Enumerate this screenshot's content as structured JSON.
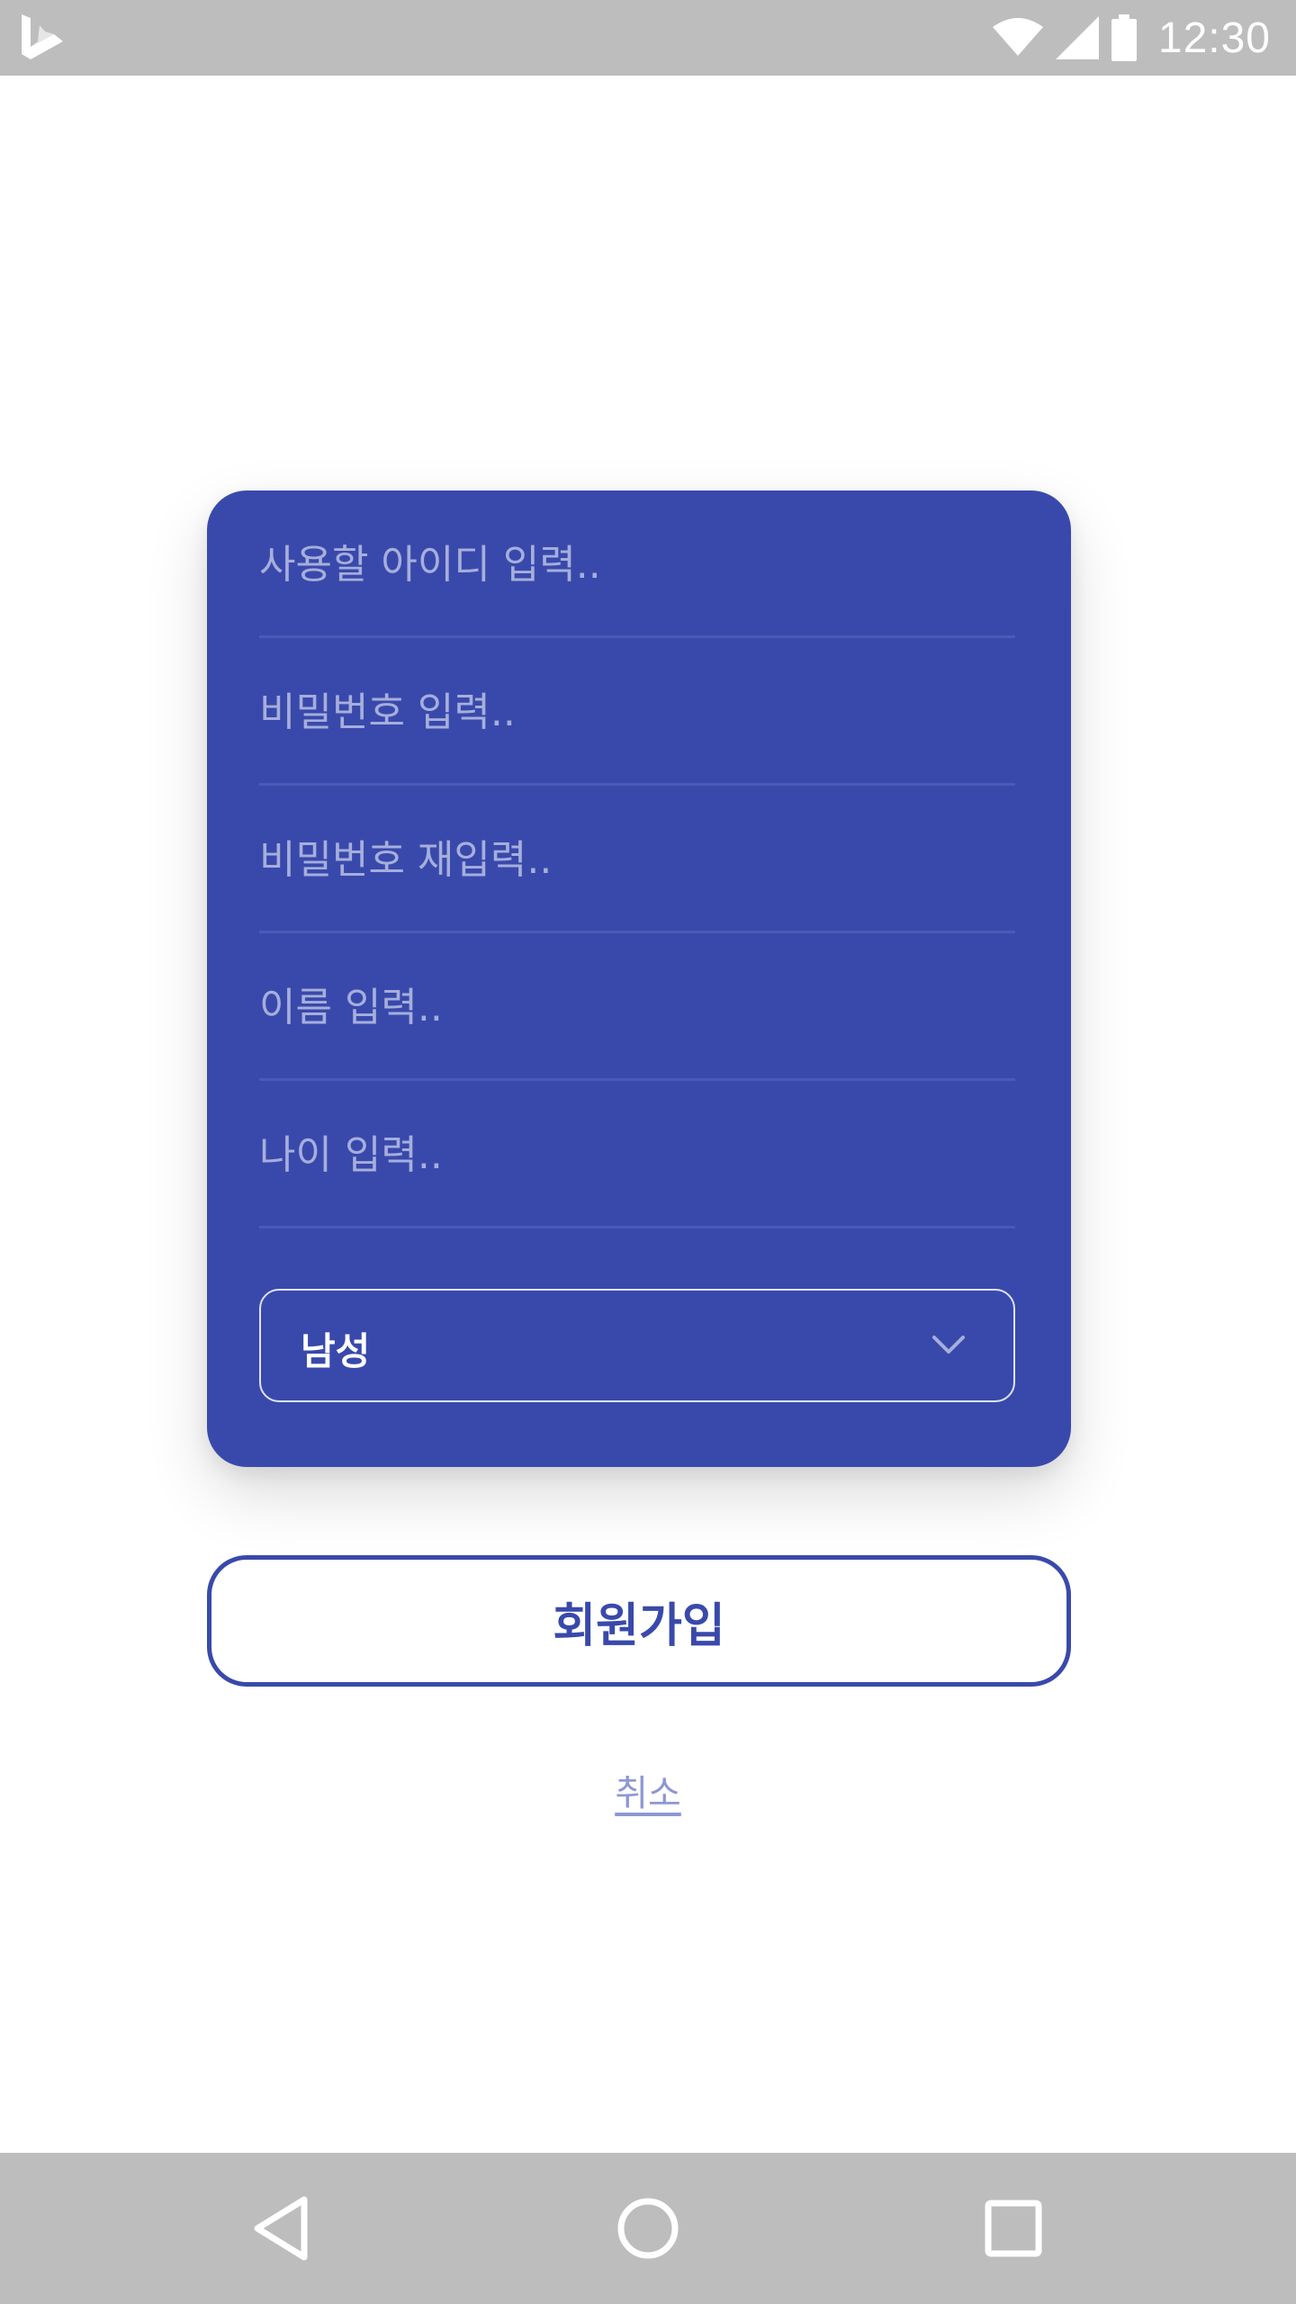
{
  "status_bar": {
    "time": "12:30",
    "icons": [
      "bing-logo-icon",
      "wifi-icon",
      "signal-icon",
      "battery-icon"
    ]
  },
  "form": {
    "fields": [
      {
        "name": "username",
        "placeholder": "사용할 아이디 입력.."
      },
      {
        "name": "password",
        "placeholder": "비밀번호 입력.."
      },
      {
        "name": "password_confirm",
        "placeholder": "비밀번호 재입력.."
      },
      {
        "name": "full_name",
        "placeholder": "이름 입력.."
      },
      {
        "name": "age",
        "placeholder": "나이 입력.."
      }
    ],
    "gender_select": {
      "value": "남성",
      "icon": "chevron-down-icon"
    }
  },
  "actions": {
    "signup_label": "회원가입",
    "cancel_label": "취소"
  },
  "nav_bar": {
    "icons": [
      "back-icon",
      "home-icon",
      "recent-apps-icon"
    ]
  },
  "colors": {
    "primary": "#3949ab",
    "placeholder": "#a6aedc",
    "cancel_link": "#8e97d3",
    "system_bar": "#bdbdbd"
  }
}
